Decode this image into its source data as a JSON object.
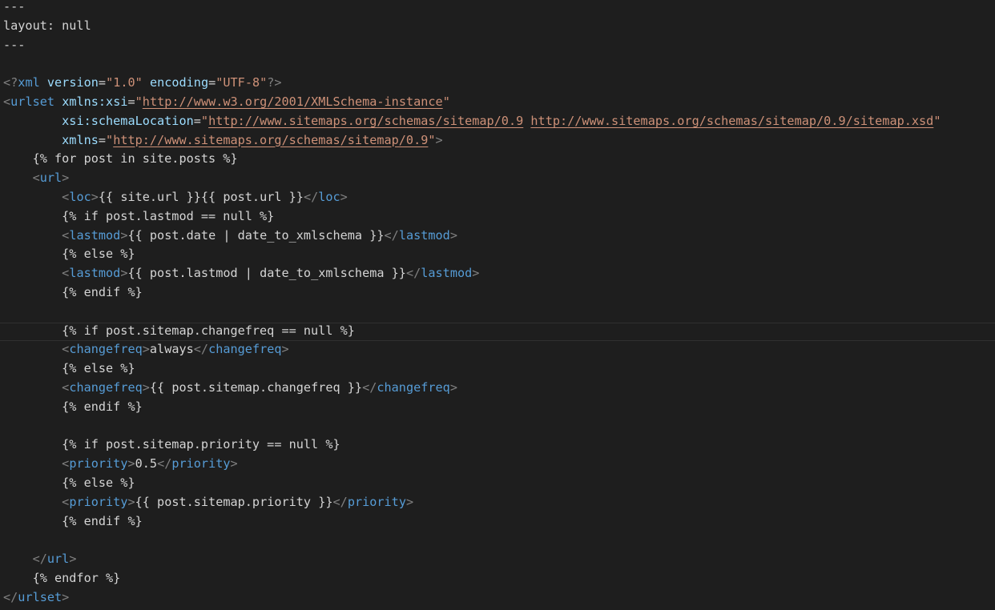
{
  "editor": {
    "colors": {
      "background": "#1e1e1e",
      "default_text": "#d4d4d4",
      "punctuation": "#808080",
      "tag": "#569cd6",
      "attribute": "#9cdcfe",
      "string": "#ce9178"
    },
    "current_line": 17,
    "lines": [
      [
        [
          "default",
          "---"
        ]
      ],
      [
        [
          "default",
          "layout: null"
        ]
      ],
      [
        [
          "default",
          "---"
        ]
      ],
      [],
      [
        [
          "punct",
          "<?"
        ],
        [
          "tag",
          "xml"
        ],
        [
          "default",
          " "
        ],
        [
          "attr",
          "version"
        ],
        [
          "default",
          "="
        ],
        [
          "str",
          "\"1.0\""
        ],
        [
          "default",
          " "
        ],
        [
          "attr",
          "encoding"
        ],
        [
          "default",
          "="
        ],
        [
          "str",
          "\"UTF-8\""
        ],
        [
          "punct",
          "?>"
        ]
      ],
      [
        [
          "punct",
          "<"
        ],
        [
          "tag",
          "urlset"
        ],
        [
          "default",
          " "
        ],
        [
          "attr",
          "xmlns:xsi"
        ],
        [
          "default",
          "="
        ],
        [
          "str",
          "\""
        ],
        [
          "link",
          "http://www.w3.org/2001/XMLSchema-instance"
        ],
        [
          "str",
          "\""
        ]
      ],
      [
        [
          "default",
          "        "
        ],
        [
          "attr",
          "xsi:schemaLocation"
        ],
        [
          "default",
          "="
        ],
        [
          "str",
          "\""
        ],
        [
          "link",
          "http://www.sitemaps.org/schemas/sitemap/0.9"
        ],
        [
          "str",
          " "
        ],
        [
          "link",
          "http://www.sitemaps.org/schemas/sitemap/0.9/sitemap.xsd"
        ],
        [
          "str",
          "\""
        ]
      ],
      [
        [
          "default",
          "        "
        ],
        [
          "attr",
          "xmlns"
        ],
        [
          "default",
          "="
        ],
        [
          "str",
          "\""
        ],
        [
          "link",
          "http://www.sitemaps.org/schemas/sitemap/0.9"
        ],
        [
          "str",
          "\""
        ],
        [
          "punct",
          ">"
        ]
      ],
      [
        [
          "default",
          "    {% for post in site.posts %}"
        ]
      ],
      [
        [
          "default",
          "    "
        ],
        [
          "punct",
          "<"
        ],
        [
          "tag",
          "url"
        ],
        [
          "punct",
          ">"
        ]
      ],
      [
        [
          "default",
          "        "
        ],
        [
          "punct",
          "<"
        ],
        [
          "tag",
          "loc"
        ],
        [
          "punct",
          ">"
        ],
        [
          "default",
          "{{ site.url }}{{ post.url }}"
        ],
        [
          "punct",
          "</"
        ],
        [
          "tag",
          "loc"
        ],
        [
          "punct",
          ">"
        ]
      ],
      [
        [
          "default",
          "        {% if post.lastmod == null %}"
        ]
      ],
      [
        [
          "default",
          "        "
        ],
        [
          "punct",
          "<"
        ],
        [
          "tag",
          "lastmod"
        ],
        [
          "punct",
          ">"
        ],
        [
          "default",
          "{{ post.date | date_to_xmlschema }}"
        ],
        [
          "punct",
          "</"
        ],
        [
          "tag",
          "lastmod"
        ],
        [
          "punct",
          ">"
        ]
      ],
      [
        [
          "default",
          "        {% else %}"
        ]
      ],
      [
        [
          "default",
          "        "
        ],
        [
          "punct",
          "<"
        ],
        [
          "tag",
          "lastmod"
        ],
        [
          "punct",
          ">"
        ],
        [
          "default",
          "{{ post.lastmod | date_to_xmlschema }}"
        ],
        [
          "punct",
          "</"
        ],
        [
          "tag",
          "lastmod"
        ],
        [
          "punct",
          ">"
        ]
      ],
      [
        [
          "default",
          "        {% endif %}"
        ]
      ],
      [],
      [
        [
          "default",
          "        {% if post.sitemap.changefreq == null %}"
        ]
      ],
      [
        [
          "default",
          "        "
        ],
        [
          "punct",
          "<"
        ],
        [
          "tag",
          "changefreq"
        ],
        [
          "punct",
          ">"
        ],
        [
          "default",
          "always"
        ],
        [
          "punct",
          "</"
        ],
        [
          "tag",
          "changefreq"
        ],
        [
          "punct",
          ">"
        ]
      ],
      [
        [
          "default",
          "        {% else %}"
        ]
      ],
      [
        [
          "default",
          "        "
        ],
        [
          "punct",
          "<"
        ],
        [
          "tag",
          "changefreq"
        ],
        [
          "punct",
          ">"
        ],
        [
          "default",
          "{{ post.sitemap.changefreq }}"
        ],
        [
          "punct",
          "</"
        ],
        [
          "tag",
          "changefreq"
        ],
        [
          "punct",
          ">"
        ]
      ],
      [
        [
          "default",
          "        {% endif %}"
        ]
      ],
      [],
      [
        [
          "default",
          "        {% if post.sitemap.priority == null %}"
        ]
      ],
      [
        [
          "default",
          "        "
        ],
        [
          "punct",
          "<"
        ],
        [
          "tag",
          "priority"
        ],
        [
          "punct",
          ">"
        ],
        [
          "default",
          "0.5"
        ],
        [
          "punct",
          "</"
        ],
        [
          "tag",
          "priority"
        ],
        [
          "punct",
          ">"
        ]
      ],
      [
        [
          "default",
          "        {% else %}"
        ]
      ],
      [
        [
          "default",
          "        "
        ],
        [
          "punct",
          "<"
        ],
        [
          "tag",
          "priority"
        ],
        [
          "punct",
          ">"
        ],
        [
          "default",
          "{{ post.sitemap.priority }}"
        ],
        [
          "punct",
          "</"
        ],
        [
          "tag",
          "priority"
        ],
        [
          "punct",
          ">"
        ]
      ],
      [
        [
          "default",
          "        {% endif %}"
        ]
      ],
      [],
      [
        [
          "default",
          "    "
        ],
        [
          "punct",
          "</"
        ],
        [
          "tag",
          "url"
        ],
        [
          "punct",
          ">"
        ]
      ],
      [
        [
          "default",
          "    {% endfor %}"
        ]
      ],
      [
        [
          "punct",
          "</"
        ],
        [
          "tag",
          "urlset"
        ],
        [
          "punct",
          ">"
        ]
      ]
    ]
  }
}
